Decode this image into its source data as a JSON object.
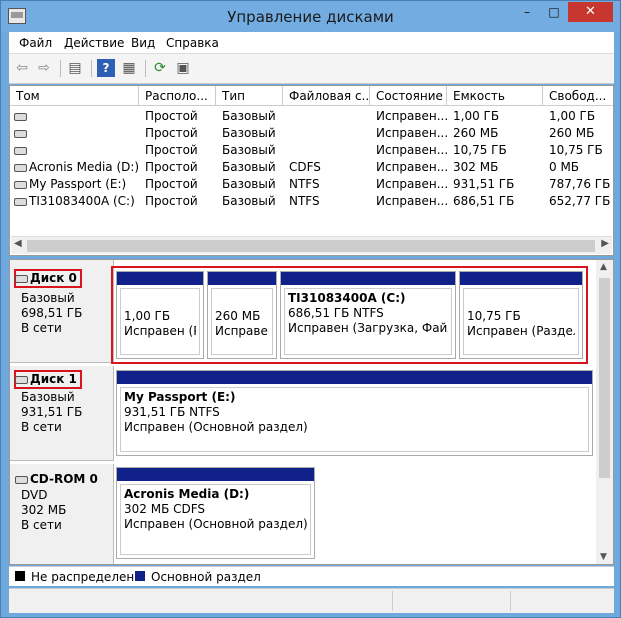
{
  "window": {
    "title": "Управление дисками",
    "minimize": "–",
    "maximize": "□",
    "close": "✕"
  },
  "menu": {
    "file": "Файл",
    "action": "Действие",
    "view": "Вид",
    "help": "Справка"
  },
  "toolbar_icons": [
    "back-arrow-icon",
    "forward-arrow-icon",
    "properties-icon",
    "help-icon",
    "list-view-icon",
    "refresh-icon",
    "rescan-icon"
  ],
  "columns": [
    "Том",
    "Располо...",
    "Тип",
    "Файловая с...",
    "Состояние",
    "Емкость",
    "Свобод..."
  ],
  "volumes": [
    {
      "name": "",
      "layout": "Простой",
      "type": "Базовый",
      "fs": "",
      "status": "Исправен...",
      "capacity": "1,00 ГБ",
      "free": "1,00 ГБ"
    },
    {
      "name": "",
      "layout": "Простой",
      "type": "Базовый",
      "fs": "",
      "status": "Исправен...",
      "capacity": "260 МБ",
      "free": "260 МБ"
    },
    {
      "name": "",
      "layout": "Простой",
      "type": "Базовый",
      "fs": "",
      "status": "Исправен...",
      "capacity": "10,75 ГБ",
      "free": "10,75 ГБ"
    },
    {
      "name": "Acronis Media (D:)",
      "layout": "Простой",
      "type": "Базовый",
      "fs": "CDFS",
      "status": "Исправен...",
      "capacity": "302 МБ",
      "free": "0 МБ"
    },
    {
      "name": "My Passport (E:)",
      "layout": "Простой",
      "type": "Базовый",
      "fs": "NTFS",
      "status": "Исправен...",
      "capacity": "931,51 ГБ",
      "free": "787,76 ГБ"
    },
    {
      "name": "TI31083400A (C:)",
      "layout": "Простой",
      "type": "Базовый",
      "fs": "NTFS",
      "status": "Исправен...",
      "capacity": "686,51 ГБ",
      "free": "652,77 ГБ"
    }
  ],
  "disks": [
    {
      "name": "Диск 0",
      "type": "Базовый",
      "size": "698,51 ГБ",
      "status": "В сети",
      "partitions": [
        {
          "title": "",
          "size": "1,00 ГБ",
          "status": "Исправен (Ра"
        },
        {
          "title": "",
          "size": "260 МБ",
          "status": "Исправен"
        },
        {
          "title": "TI31083400A  (C:)",
          "size": "686,51 ГБ NTFS",
          "status": "Исправен (Загрузка, Файл по"
        },
        {
          "title": "",
          "size": "10,75 ГБ",
          "status": "Исправен (Раздел во"
        }
      ]
    },
    {
      "name": "Диск 1",
      "type": "Базовый",
      "size": "931,51 ГБ",
      "status": "В сети",
      "partitions": [
        {
          "title": "My Passport  (E:)",
          "size": "931,51 ГБ NTFS",
          "status": "Исправен (Основной раздел)"
        }
      ]
    },
    {
      "name": "CD-ROM 0",
      "type": "DVD",
      "size": "302 МБ",
      "status": "В сети",
      "partitions": [
        {
          "title": "Acronis Media  (D:)",
          "size": "302 МБ CDFS",
          "status": "Исправен (Основной раздел)"
        }
      ]
    }
  ],
  "legend": {
    "unallocated": "Не распределена",
    "primary": "Основной раздел",
    "unallocated_color": "#000000",
    "primary_color": "#10228a"
  },
  "colors": {
    "highlight": "#d9141e",
    "titlebar": "#73ace0",
    "close": "#c7372f"
  }
}
